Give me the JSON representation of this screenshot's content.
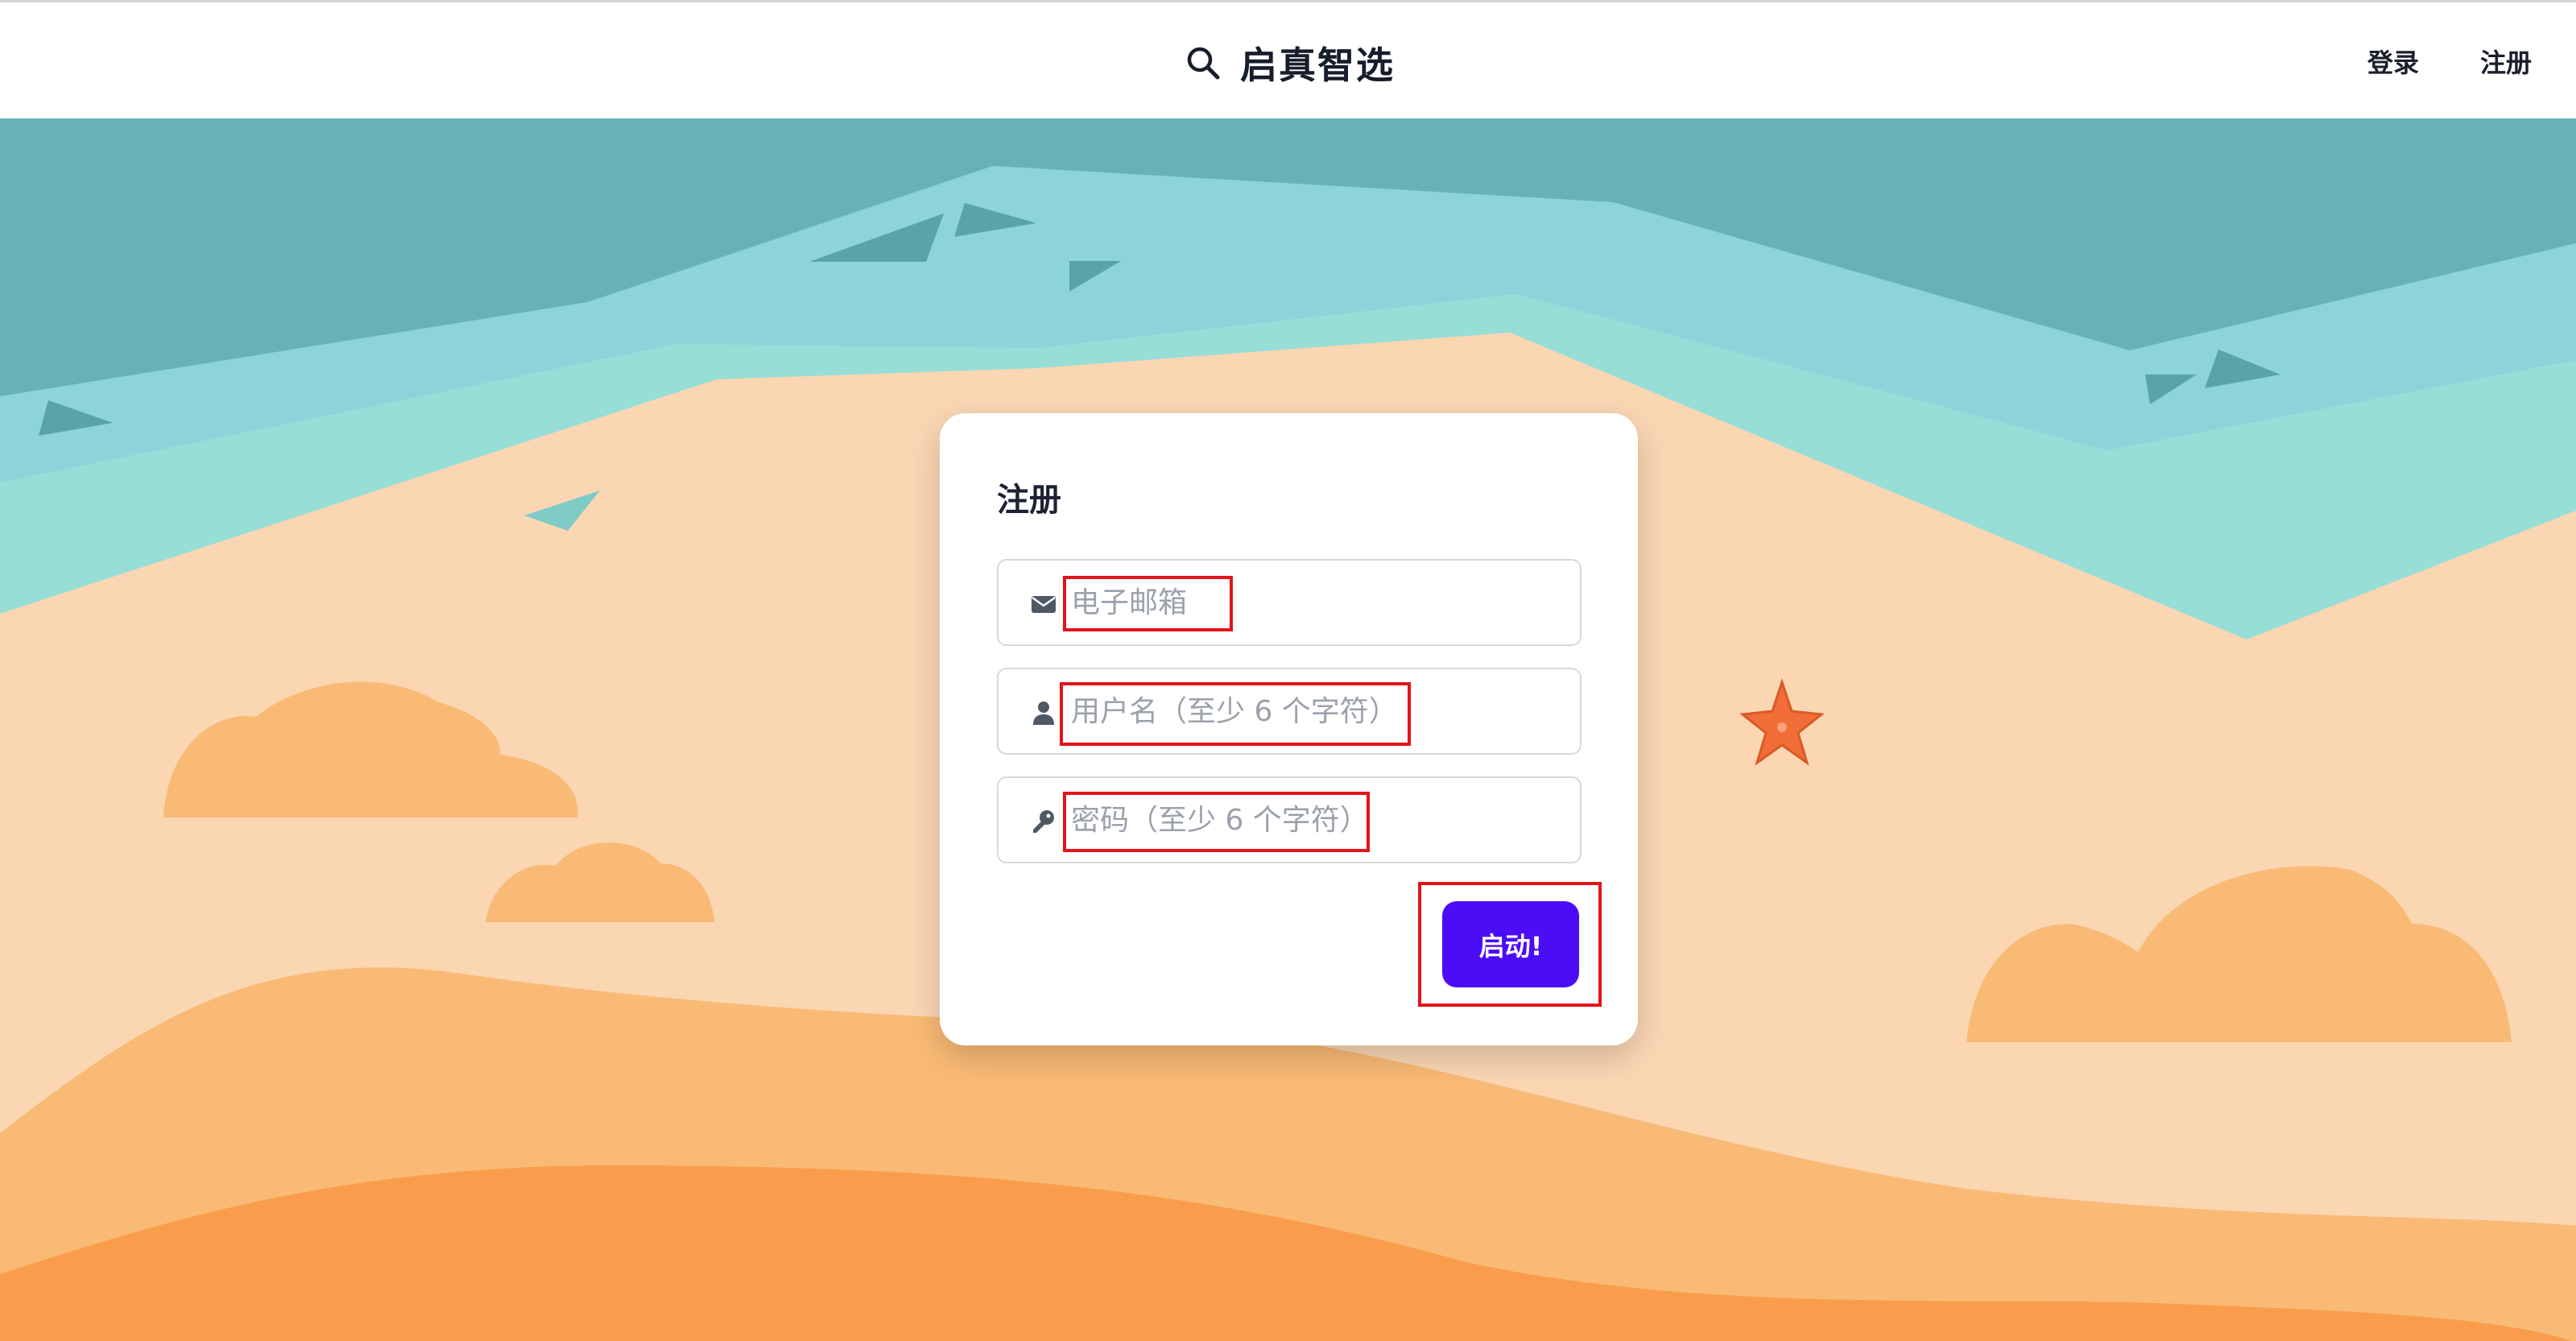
{
  "header": {
    "brand_icon": "search-icon",
    "brand_title": "启真智选",
    "nav": {
      "login": "登录",
      "register": "注册"
    }
  },
  "form": {
    "title": "注册",
    "email": {
      "icon": "envelope-icon",
      "placeholder": "电子邮箱",
      "value": ""
    },
    "username": {
      "icon": "user-icon",
      "placeholder": "用户名（至少 6 个字符）",
      "value": ""
    },
    "password": {
      "icon": "key-icon",
      "placeholder": "密码（至少 6 个字符）",
      "value": ""
    },
    "submit_label": "启动!"
  },
  "theme": {
    "accent": "#4b0df5",
    "highlight": "#e4131a",
    "sea_dark": "#67b2b8",
    "sea_light": "#8cd3dc",
    "foam": "#97ded7",
    "sand": "#fad6b3",
    "dune": "#f9ba75",
    "dune_dark": "#f99d4c",
    "starfish": "#f26d37"
  }
}
